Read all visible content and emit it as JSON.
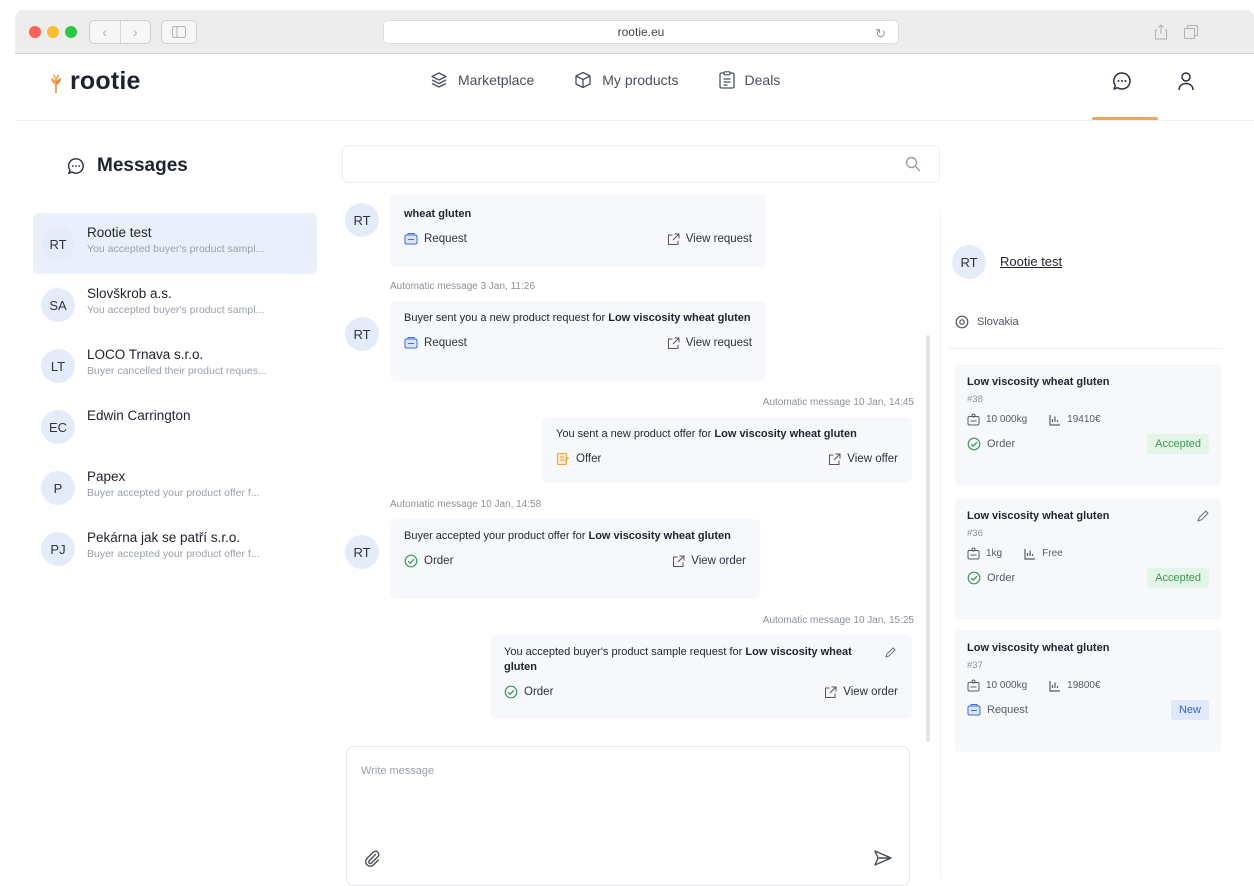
{
  "browser": {
    "url": "rootie.eu"
  },
  "brand": {
    "name": "rootie",
    "accent": "#f0a35a"
  },
  "nav": {
    "items": [
      {
        "label": "Marketplace",
        "icon": "box-stack-icon"
      },
      {
        "label": "My products",
        "icon": "box-icon"
      },
      {
        "label": "Deals",
        "icon": "document-icon"
      }
    ]
  },
  "messages": {
    "title": "Messages"
  },
  "conversations": [
    {
      "initials": "RT",
      "name": "Rootie test",
      "preview": "You accepted buyer's product sampl..."
    },
    {
      "initials": "SA",
      "name": "Slovškrob a.s.",
      "preview": "You accepted buyer's product sampl..."
    },
    {
      "initials": "LT",
      "name": "LOCO Trnava s.r.o.",
      "preview": "Buyer cancelled their product reques..."
    },
    {
      "initials": "EC",
      "name": "Edwin Carrington",
      "preview": ""
    },
    {
      "initials": "P",
      "name": "Papex",
      "preview": "Buyer accepted your product offer f..."
    },
    {
      "initials": "PJ",
      "name": "Pekárna jak se patří s.r.o.",
      "preview": "Buyer accepted your product offer f..."
    }
  ],
  "search": {
    "placeholder": ""
  },
  "chat": {
    "messages": [
      {
        "avatar": "RT",
        "label": "",
        "text_plain": "",
        "text_bold": "wheat gluten",
        "left_action": "Request",
        "right_action": "View request"
      },
      {
        "avatar": "RT",
        "label": "Automatic message 3 Jan, 11:26",
        "text_plain": "Buyer sent you a new product request for ",
        "text_bold": "Low viscosity wheat gluten",
        "left_action": "Request",
        "right_action": "View request"
      },
      {
        "avatar": "",
        "label": "Automatic message 10 Jan, 14:45",
        "text_plain": "You sent a new product offer for ",
        "text_bold": "Low viscosity wheat gluten",
        "left_action": "Offer",
        "right_action": "View offer"
      },
      {
        "avatar": "RT",
        "label": "Automatic message 10 Jan, 14:58",
        "text_plain": "Buyer accepted your product offer for ",
        "text_bold": "Low viscosity wheat gluten",
        "left_action": "Order",
        "right_action": "View order"
      },
      {
        "avatar": "",
        "label": "Automatic message 10 Jan, 15:25",
        "text_plain": "You accepted buyer's product sample request for ",
        "text_bold": "Low viscosity wheat gluten",
        "left_action": "Order",
        "right_action": "View order"
      }
    ]
  },
  "composer": {
    "placeholder": "Write message"
  },
  "contact": {
    "initials": "RT",
    "name": "Rootie test",
    "location": "Slovakia"
  },
  "deals": [
    {
      "title": "Low viscosity wheat gluten",
      "id": "#38",
      "quantity": "10 000kg",
      "price": "19410€",
      "kind": "Order",
      "status": "Accepted"
    },
    {
      "title": "Low viscosity wheat gluten",
      "id": "#36",
      "quantity": "1kg",
      "price": "Free",
      "kind": "Order",
      "status": "Accepted"
    },
    {
      "title": "Low viscosity wheat gluten",
      "id": "#37",
      "quantity": "10 000kg",
      "price": "19800€",
      "kind": "Request",
      "status": "New"
    }
  ]
}
